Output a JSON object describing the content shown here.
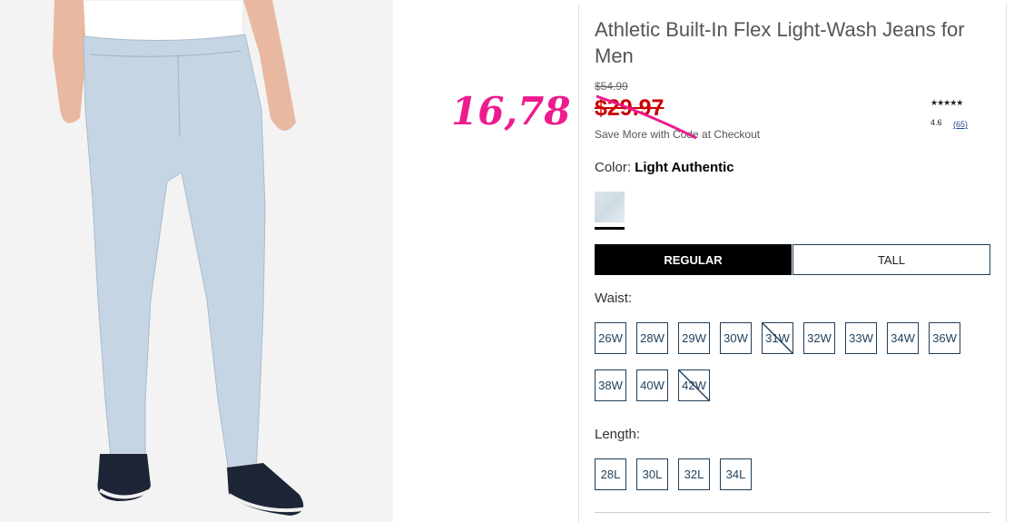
{
  "product": {
    "title": "Athletic Built-In Flex Light-Wash Jeans for Men",
    "original_price": "$54.99",
    "sale_price": "$29.97",
    "save_more": "Save More with Code at Checkout",
    "stars": "★★★★★",
    "rating": "4.6",
    "reviews": "(65)",
    "color_label": "Color:",
    "color_value": "Light Authentic"
  },
  "annotation": {
    "handwritten_price": "16,78",
    "color": "#ee1b8e"
  },
  "fit": {
    "regular_label": "REGULAR",
    "tall_label": "TALL",
    "selected": "REGULAR"
  },
  "waist": {
    "label": "Waist:",
    "sizes": [
      {
        "label": "26W",
        "available": true
      },
      {
        "label": "28W",
        "available": true
      },
      {
        "label": "29W",
        "available": true
      },
      {
        "label": "30W",
        "available": true
      },
      {
        "label": "31W",
        "available": false
      },
      {
        "label": "32W",
        "available": true
      },
      {
        "label": "33W",
        "available": true
      },
      {
        "label": "34W",
        "available": true
      },
      {
        "label": "36W",
        "available": true
      },
      {
        "label": "38W",
        "available": true
      },
      {
        "label": "40W",
        "available": true
      },
      {
        "label": "42W",
        "available": false
      }
    ]
  },
  "length": {
    "label": "Length:",
    "sizes": [
      {
        "label": "28L",
        "available": true
      },
      {
        "label": "30L",
        "available": true
      },
      {
        "label": "32L",
        "available": true
      },
      {
        "label": "34L",
        "available": true
      }
    ]
  },
  "colors": {
    "sale": "#cc0000",
    "accent": "#1f3f5b",
    "strike": "#ee1b8e"
  }
}
